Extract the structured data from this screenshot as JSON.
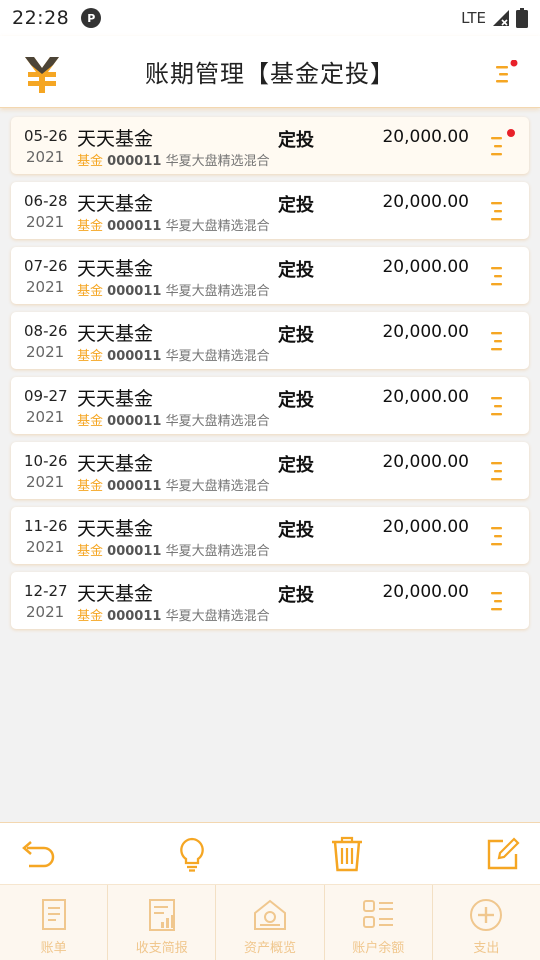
{
  "status": {
    "time": "22:28",
    "network": "LTE"
  },
  "header": {
    "title": "账期管理【基金定投】"
  },
  "records": [
    {
      "date": "05-26",
      "year": "2021",
      "name": "天天基金",
      "category": "基金",
      "code": "000011",
      "fund": "华夏大盘精选混合",
      "type": "定投",
      "amount": "20,000.00",
      "flagged": true
    },
    {
      "date": "06-28",
      "year": "2021",
      "name": "天天基金",
      "category": "基金",
      "code": "000011",
      "fund": "华夏大盘精选混合",
      "type": "定投",
      "amount": "20,000.00",
      "flagged": false
    },
    {
      "date": "07-26",
      "year": "2021",
      "name": "天天基金",
      "category": "基金",
      "code": "000011",
      "fund": "华夏大盘精选混合",
      "type": "定投",
      "amount": "20,000.00",
      "flagged": false
    },
    {
      "date": "08-26",
      "year": "2021",
      "name": "天天基金",
      "category": "基金",
      "code": "000011",
      "fund": "华夏大盘精选混合",
      "type": "定投",
      "amount": "20,000.00",
      "flagged": false
    },
    {
      "date": "09-27",
      "year": "2021",
      "name": "天天基金",
      "category": "基金",
      "code": "000011",
      "fund": "华夏大盘精选混合",
      "type": "定投",
      "amount": "20,000.00",
      "flagged": false
    },
    {
      "date": "10-26",
      "year": "2021",
      "name": "天天基金",
      "category": "基金",
      "code": "000011",
      "fund": "华夏大盘精选混合",
      "type": "定投",
      "amount": "20,000.00",
      "flagged": false
    },
    {
      "date": "11-26",
      "year": "2021",
      "name": "天天基金",
      "category": "基金",
      "code": "000011",
      "fund": "华夏大盘精选混合",
      "type": "定投",
      "amount": "20,000.00",
      "flagged": false
    },
    {
      "date": "12-27",
      "year": "2021",
      "name": "天天基金",
      "category": "基金",
      "code": "000011",
      "fund": "华夏大盘精选混合",
      "type": "定投",
      "amount": "20,000.00",
      "flagged": false
    }
  ],
  "toolbar": {
    "icons": [
      "back-icon",
      "lightbulb-icon",
      "trash-icon",
      "edit-icon"
    ]
  },
  "tabs": [
    {
      "label": "账单",
      "icon": "bill-icon"
    },
    {
      "label": "收支简报",
      "icon": "report-icon"
    },
    {
      "label": "资产概览",
      "icon": "assets-icon"
    },
    {
      "label": "账户余额",
      "icon": "balance-icon"
    },
    {
      "label": "支出",
      "icon": "add-expense-icon"
    }
  ],
  "colors": {
    "accent": "#f5a623",
    "alert": "#e8212a",
    "tab_label": "#f0c78e"
  }
}
